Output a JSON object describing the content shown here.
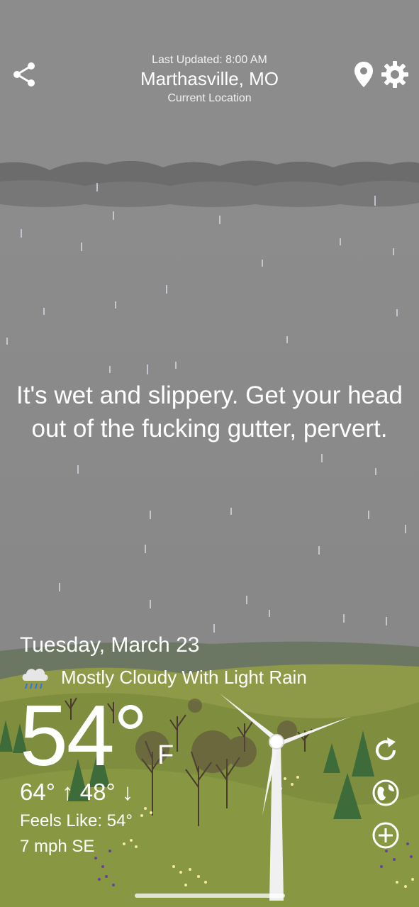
{
  "header": {
    "last_updated": "Last Updated: 8:00 AM",
    "city": "Marthasville, MO",
    "sublabel": "Current Location"
  },
  "message": "It's wet and slippery. Get your head out of the fucking gutter, pervert.",
  "weather": {
    "date": "Tuesday, March 23",
    "condition": "Mostly Cloudy With Light Rain",
    "condition_icon": "cloud-rain-icon",
    "temperature": "54°",
    "unit": "F",
    "hi_lo": "64° ↑  48° ↓",
    "feels_like": "Feels Like: 54°",
    "wind": "7 mph SE"
  },
  "icons": {
    "share": "share-icon",
    "location": "location-pin-icon",
    "settings": "gear-icon",
    "refresh": "refresh-icon",
    "radar": "radar-globe-icon",
    "add": "add-location-icon"
  },
  "colors": {
    "sky": "#8a8a8a",
    "cloud_band": "#6e6e6e",
    "hill_far": "#9aa75a",
    "hill_near": "#8b9a47",
    "tree_dark": "#3f6a3a"
  }
}
